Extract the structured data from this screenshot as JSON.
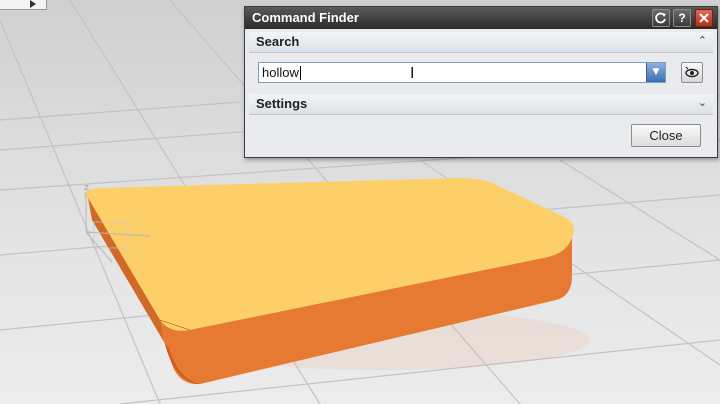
{
  "dialog": {
    "title": "Command Finder",
    "buttons": {
      "reset_icon": "reset-icon",
      "help_label": "?",
      "close_icon": "close-icon"
    },
    "search": {
      "header": "Search",
      "value": "hollow",
      "collapse_icon": "chevron-up-icon",
      "dropdown_icon": "dropdown-arrow-icon",
      "filter_icon": "eye-icon"
    },
    "settings": {
      "header": "Settings",
      "expand_icon": "chevron-down-icon"
    },
    "close_label": "Close"
  },
  "viewport": {
    "model": "block-icon",
    "colors": {
      "top_face": "#FDCF68",
      "side_face": "#E67A33",
      "grid": "#B4B4B4"
    }
  }
}
